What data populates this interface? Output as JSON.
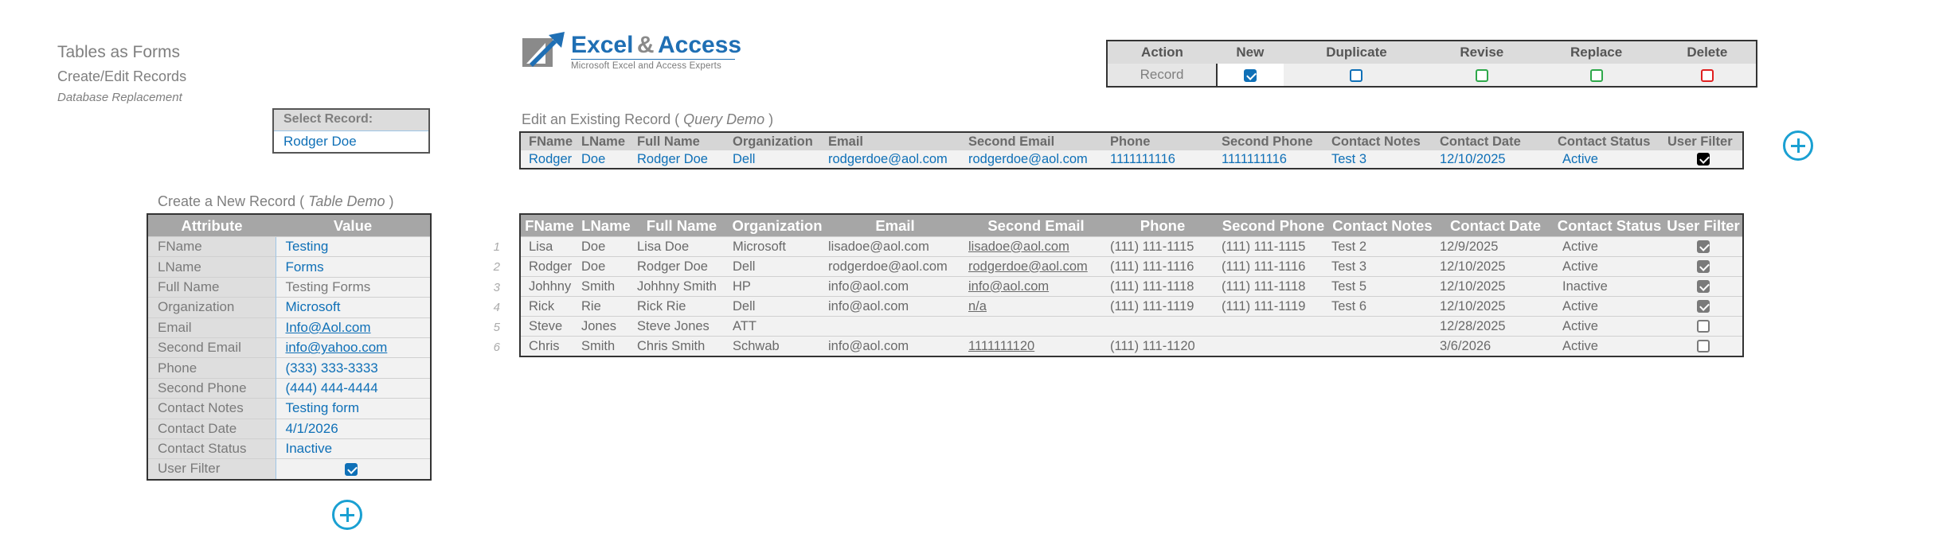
{
  "header": {
    "title": "Tables as Forms",
    "subtitle": "Create/Edit Records",
    "caption": "Database Replacement"
  },
  "logo": {
    "word1": "Excel",
    "amp": "&",
    "word2": "Access",
    "tagline": "Microsoft Excel and Access Experts"
  },
  "actions": {
    "headers": [
      "Action",
      "New",
      "Duplicate",
      "Revise",
      "Replace",
      "Delete"
    ],
    "row_label": "Record",
    "checkboxes": [
      {
        "name": "new",
        "checked": true,
        "color": "#0f70b7"
      },
      {
        "name": "duplicate",
        "checked": false,
        "color": "#0f70b7"
      },
      {
        "name": "revise",
        "checked": false,
        "color": "#2ea84a"
      },
      {
        "name": "replace",
        "checked": false,
        "color": "#2ea84a"
      },
      {
        "name": "delete",
        "checked": false,
        "color": "#e02020"
      }
    ]
  },
  "select_record": {
    "label": "Select Record:",
    "value": "Rodger Doe"
  },
  "edit_existing": {
    "title_prefix": "Edit an Existing Record (",
    "title_italic": "Query Demo",
    "title_suffix": ")",
    "columns": [
      "FName",
      "LName",
      "Full Name",
      "Organization",
      "Email",
      "Second Email",
      "Phone",
      "Second Phone",
      "Contact Notes",
      "Contact Date",
      "Contact Status",
      "User Filter"
    ],
    "row": [
      "Rodger",
      "Doe",
      "Rodger Doe",
      "Dell",
      "rodgerdoe@aol.com",
      "rodgerdoe@aol.com",
      "1111111116",
      "1111111116",
      "Test 3",
      "12/10/2025",
      "Active",
      true
    ]
  },
  "create_new": {
    "title_prefix": "Create a New Record (",
    "title_italic": "Table Demo",
    "title_suffix": ")",
    "headers": [
      "Attribute",
      "Value"
    ],
    "rows": [
      {
        "key": "FName",
        "value": "Testing"
      },
      {
        "key": "LName",
        "value": "Forms"
      },
      {
        "key": "Full Name",
        "value": "Testing Forms"
      },
      {
        "key": "Organization",
        "value": "Microsoft"
      },
      {
        "key": "Email",
        "value": "Info@Aol.com"
      },
      {
        "key": "Second Email",
        "value": "info@yahoo.com"
      },
      {
        "key": "Phone",
        "value": "(333) 333-3333"
      },
      {
        "key": "Second Phone",
        "value": "(444) 444-4444"
      },
      {
        "key": "Contact Notes",
        "value": "Testing form"
      },
      {
        "key": "Contact Date",
        "value": "4/1/2026"
      },
      {
        "key": "Contact Status",
        "value": "Inactive"
      },
      {
        "key": "User Filter",
        "value": ""
      }
    ],
    "user_filter_checked": true
  },
  "data_table": {
    "columns": [
      "FName",
      "LName",
      "Full Name",
      "Organization",
      "Email",
      "Second Email",
      "Phone",
      "Second Phone",
      "Contact Notes",
      "Contact Date",
      "Contact Status",
      "User Filter"
    ],
    "row_numbers": [
      "1",
      "2",
      "3",
      "4",
      "5",
      "6"
    ],
    "rows": [
      [
        "Lisa",
        "Doe",
        "Lisa Doe",
        "Microsoft",
        "lisadoe@aol.com",
        "lisadoe@aol.com",
        "(111) 111-1115",
        "(111) 111-1115",
        "Test 2",
        "12/9/2025",
        "Active",
        true
      ],
      [
        "Rodger",
        "Doe",
        "Rodger Doe",
        "Dell",
        "rodgerdoe@aol.com",
        "rodgerdoe@aol.com",
        "(111) 111-1116",
        "(111) 111-1116",
        "Test 3",
        "12/10/2025",
        "Active",
        true
      ],
      [
        "Johhny",
        "Smith",
        "Johhny Smith",
        "HP",
        "info@aol.com",
        "info@aol.com",
        "(111) 111-1118",
        "(111) 111-1118",
        "Test 5",
        "12/10/2025",
        "Inactive",
        true
      ],
      [
        "Rick",
        "Rie",
        "Rick Rie",
        "Dell",
        "info@aol.com",
        "n/a",
        "(111) 111-1119",
        "(111) 111-1119",
        "Test 6",
        "12/10/2025",
        "Active",
        true
      ],
      [
        "Steve",
        "Jones",
        "Steve Jones",
        "ATT",
        "",
        "",
        "",
        "",
        "",
        "12/28/2025",
        "Active",
        false
      ],
      [
        "Chris",
        "Smith",
        "Chris Smith",
        "Schwab",
        "info@aol.com",
        "1111111120",
        "(111) 111-1120",
        "",
        "",
        "3/6/2026",
        "Active",
        false
      ]
    ]
  }
}
